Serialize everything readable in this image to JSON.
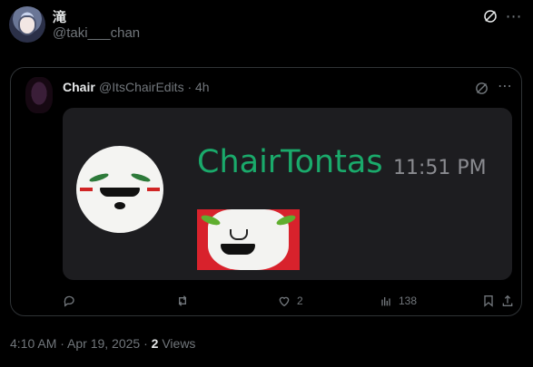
{
  "author": {
    "display_name": "滝",
    "handle": "@taki___chan"
  },
  "quote": {
    "author_name": "Chair",
    "author_handle_time": "@ItsChairEdits · 4h",
    "media": {
      "username": "ChairTontas",
      "time": "11:51 PM"
    },
    "actions": {
      "reply_count": "",
      "repost_count": "",
      "like_count": "2",
      "views_count": "138"
    }
  },
  "footer": {
    "timestamp": "4:10 AM · Apr 19, 2025 · ",
    "views_count": "2",
    "views_label": " Views"
  },
  "icons": [
    "grok-icon",
    "more-icon",
    "reply-icon",
    "repost-icon",
    "like-icon",
    "views-icon",
    "bookmark-icon",
    "share-icon"
  ],
  "colors": {
    "accent_green": "#1aaa6b",
    "muted": "#71767b",
    "card_bg": "#1d1d20"
  }
}
